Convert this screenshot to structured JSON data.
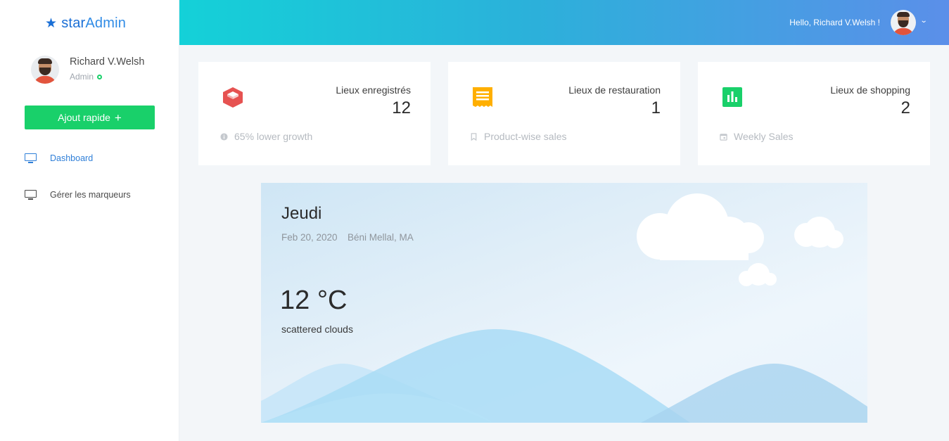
{
  "brand": {
    "name_part1": "star",
    "name_part2": "Admin",
    "icon": "star-icon"
  },
  "sidebar": {
    "profile": {
      "name": "Richard V.Welsh",
      "role": "Admin"
    },
    "quick_add": {
      "label": "Ajout rapide",
      "icon": "plus-icon"
    },
    "items": [
      {
        "label": "Dashboard",
        "icon": "monitor-icon",
        "active": true
      },
      {
        "label": "Gérer les marqueurs",
        "icon": "monitor-icon",
        "active": false
      }
    ]
  },
  "header": {
    "greeting": "Hello, Richard V.Welsh !"
  },
  "cards": [
    {
      "label": "Lieux enregistrés",
      "value": "12",
      "footer": "65% lower growth",
      "icon": "cube-icon",
      "footer_icon": "info-icon",
      "color": "#e65251"
    },
    {
      "label": "Lieux de restauration",
      "value": "1",
      "footer": "Product-wise sales",
      "icon": "receipt-icon",
      "footer_icon": "bookmark-icon",
      "color": "#ffaf00"
    },
    {
      "label": "Lieux de shopping",
      "value": "2",
      "footer": "Weekly Sales",
      "icon": "bar-chart-icon",
      "footer_icon": "calendar-icon",
      "color": "#19d06a"
    }
  ],
  "weather": {
    "day": "Jeudi",
    "date": "Feb 20, 2020",
    "location": "Béni Mellal, MA",
    "temperature": "12 °C",
    "description": "scattered clouds"
  },
  "colors": {
    "accent": "#2f7fd8",
    "success": "#19d06a",
    "header_start": "#14d1d8",
    "header_end": "#5b8fe9"
  }
}
